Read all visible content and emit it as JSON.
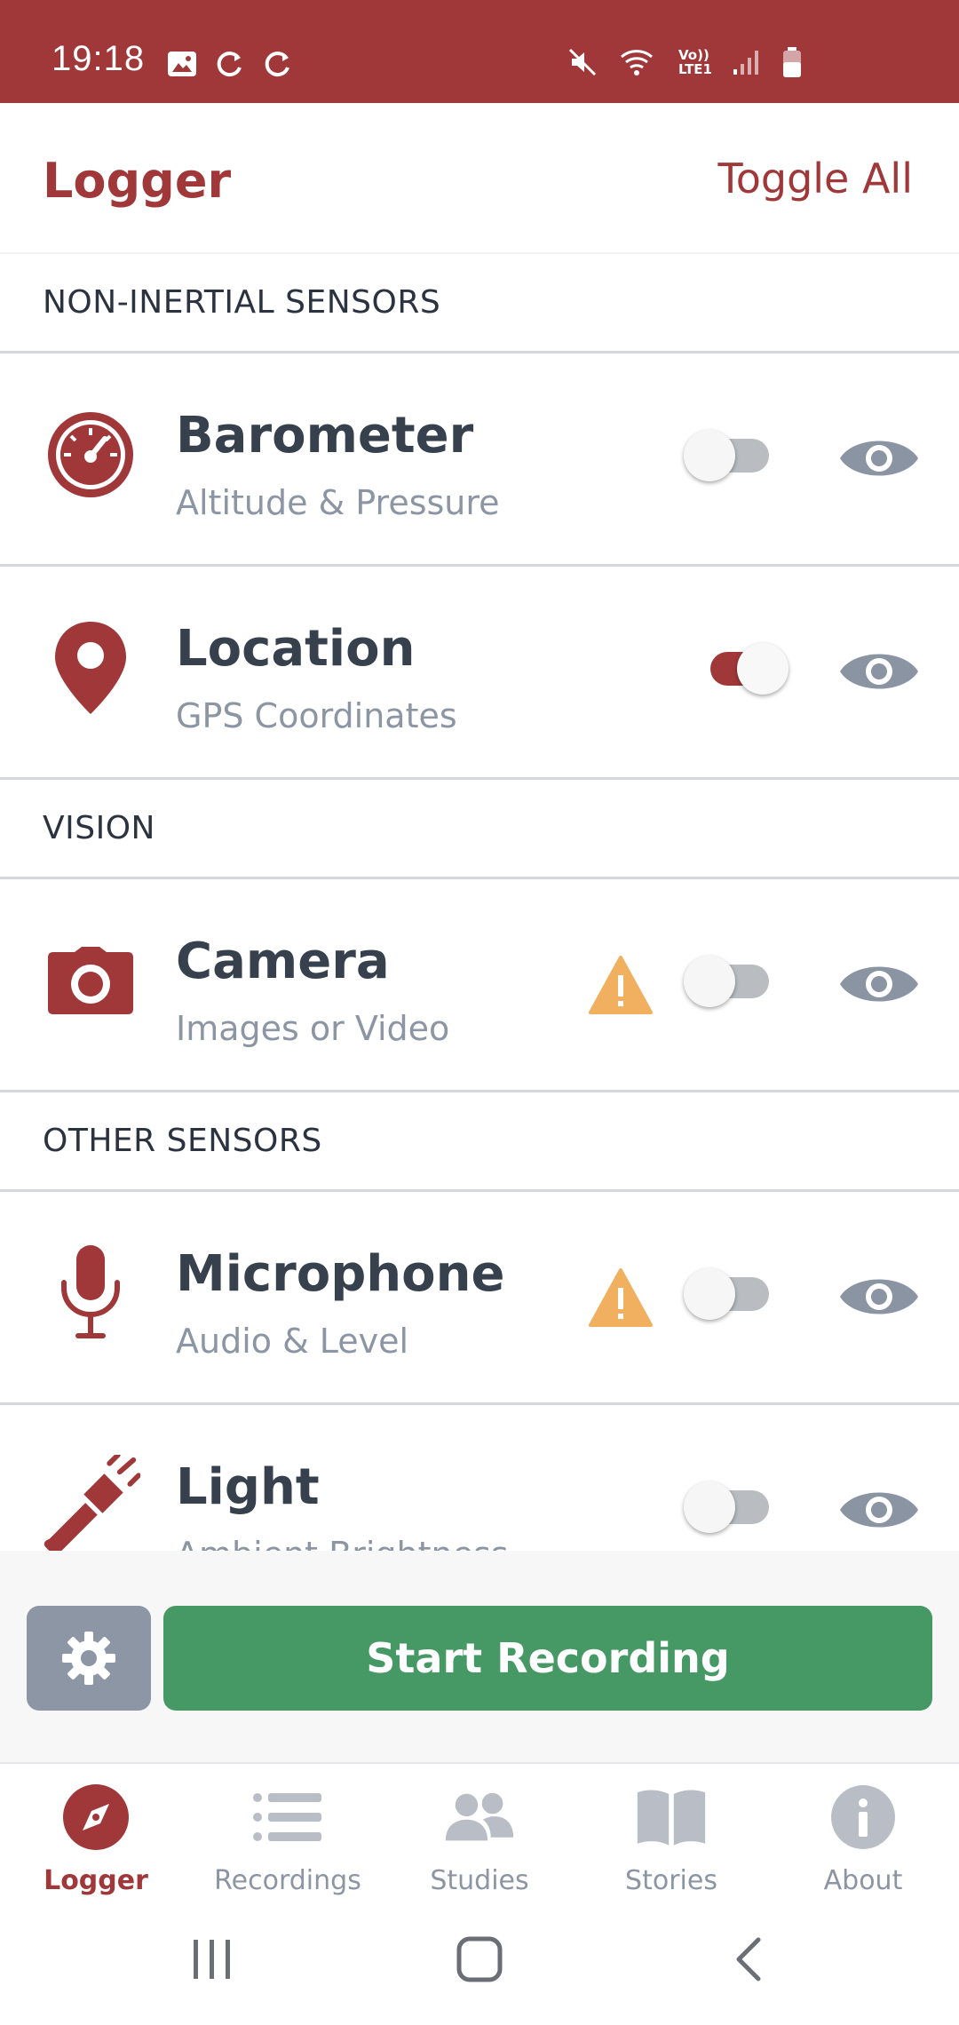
{
  "status_bar": {
    "time": "19:18",
    "left_icons": [
      "gallery-icon",
      "sync-icon",
      "sync-icon"
    ],
    "right_icons": [
      "mute-icon",
      "wifi-icon",
      "volte-icon",
      "signal-icon",
      "battery-icon"
    ],
    "volte_label_top": "Vo))",
    "volte_label_bottom": "LTE1"
  },
  "header": {
    "title": "Logger",
    "toggle_all": "Toggle All"
  },
  "sections": [
    {
      "title": "NON-INERTIAL SENSORS",
      "rows": [
        {
          "title": "Barometer",
          "subtitle": "Altitude & Pressure",
          "icon": "gauge-icon",
          "enabled": false,
          "warning": false
        },
        {
          "title": "Location",
          "subtitle": "GPS Coordinates",
          "icon": "map-pin-icon",
          "enabled": true,
          "warning": false
        }
      ]
    },
    {
      "title": "VISION",
      "rows": [
        {
          "title": "Camera",
          "subtitle": "Images or Video",
          "icon": "camera-icon",
          "enabled": false,
          "warning": true
        }
      ]
    },
    {
      "title": "OTHER SENSORS",
      "rows": [
        {
          "title": "Microphone",
          "subtitle": "Audio & Level",
          "icon": "microphone-icon",
          "enabled": false,
          "warning": true
        },
        {
          "title": "Light",
          "subtitle": "Ambient Brightness",
          "icon": "flashlight-icon",
          "enabled": false,
          "warning": false
        }
      ]
    }
  ],
  "actions": {
    "settings_icon": "gear-icon",
    "record_label": "Start Recording"
  },
  "tabs": [
    {
      "label": "Logger",
      "icon": "compass-icon",
      "active": true
    },
    {
      "label": "Recordings",
      "icon": "list-icon",
      "active": false
    },
    {
      "label": "Studies",
      "icon": "users-icon",
      "active": false
    },
    {
      "label": "Stories",
      "icon": "book-icon",
      "active": false
    },
    {
      "label": "About",
      "icon": "info-icon",
      "active": false
    }
  ],
  "colors": {
    "brand": "#a0383a",
    "primary_action": "#469965",
    "warning": "#f0b060",
    "muted": "#8c95a3"
  }
}
